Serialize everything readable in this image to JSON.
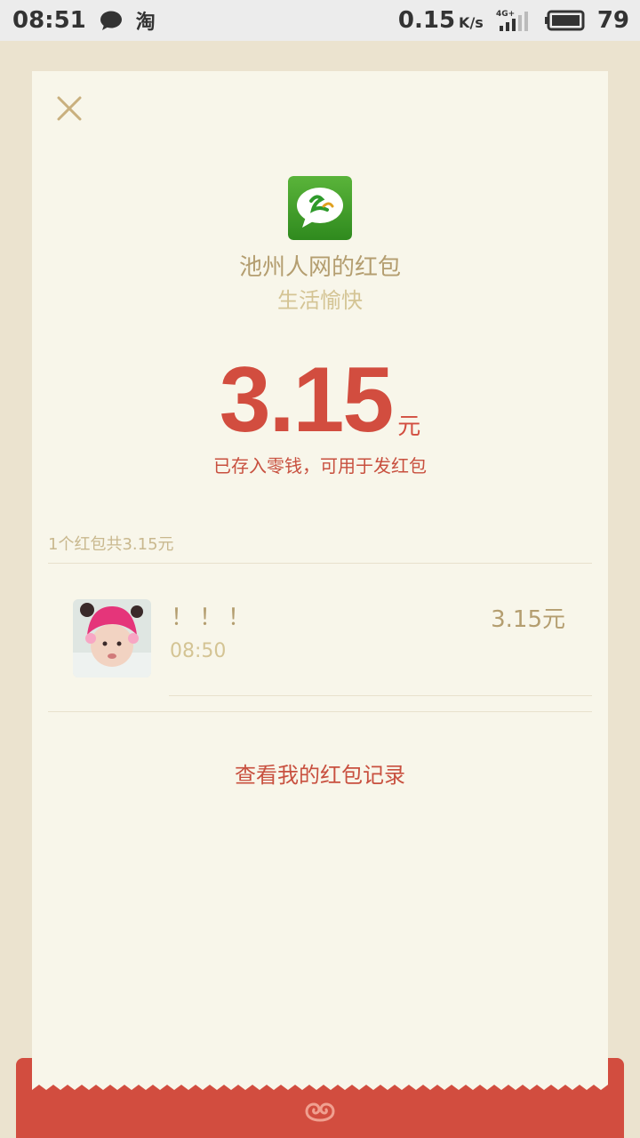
{
  "status_bar": {
    "time": "08:51",
    "app_icon_1": "chat-bubble-icon",
    "app_icon_2_label": "淘",
    "network_speed": "0.15",
    "network_unit": "K/s",
    "network_type": "4G+",
    "battery": "79"
  },
  "card": {
    "close_icon": "close-icon",
    "sender_name": "池州人网的红包",
    "greeting": "生活愉快",
    "amount": "3.15",
    "amount_unit": "元",
    "saved_note": "已存入零钱，可用于发红包",
    "summary": "1个红包共3.15元",
    "packet": {
      "message": "！！！",
      "time": "08:50",
      "amount": "3.15元"
    },
    "records_link": "查看我的红包记录"
  },
  "colors": {
    "background": "#ebe3cf",
    "card": "#f8f6ea",
    "accent_red": "#d24d3f",
    "gold_text": "#b49e70",
    "light_gold": "#d4c494"
  }
}
